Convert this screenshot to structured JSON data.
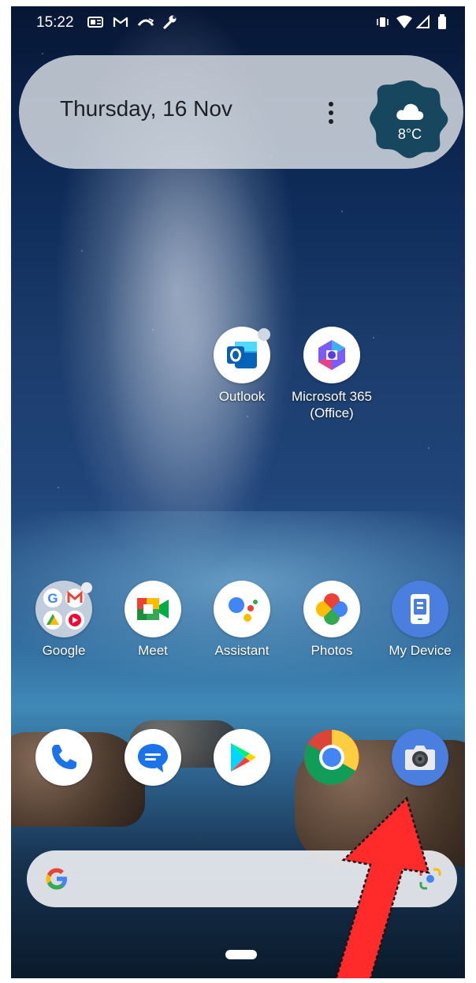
{
  "status_bar": {
    "time": "15:22",
    "icons": [
      "outlook-notification-icon",
      "gmail-icon",
      "missed-call-icon",
      "wrench-icon",
      "vibrate-icon",
      "wifi-icon",
      "signal-icon",
      "battery-icon"
    ]
  },
  "glance_widget": {
    "date": "Thursday, 16 Nov",
    "weather_temp": "8°C",
    "weather_icon": "cloud-icon"
  },
  "apps_row1": [
    {
      "label": "Outlook",
      "icon": "outlook-icon"
    },
    {
      "label": "Microsoft 365\n(Office)",
      "icon": "microsoft-365-icon"
    }
  ],
  "apps_row2": [
    {
      "label": "Google",
      "icon": "google-folder-icon"
    },
    {
      "label": "Meet",
      "icon": "meet-icon"
    },
    {
      "label": "Assistant",
      "icon": "assistant-icon"
    },
    {
      "label": "Photos",
      "icon": "photos-icon"
    },
    {
      "label": "My Device",
      "icon": "my-device-icon"
    }
  ],
  "dock": [
    {
      "icon": "phone-icon"
    },
    {
      "icon": "messages-icon"
    },
    {
      "icon": "play-store-icon"
    },
    {
      "icon": "chrome-icon"
    },
    {
      "icon": "camera-icon"
    }
  ],
  "search_bar": {
    "icon": "google-g-icon"
  },
  "colors": {
    "annotation_arrow": "#ff2a2a",
    "weather_badge": "#16475e"
  }
}
